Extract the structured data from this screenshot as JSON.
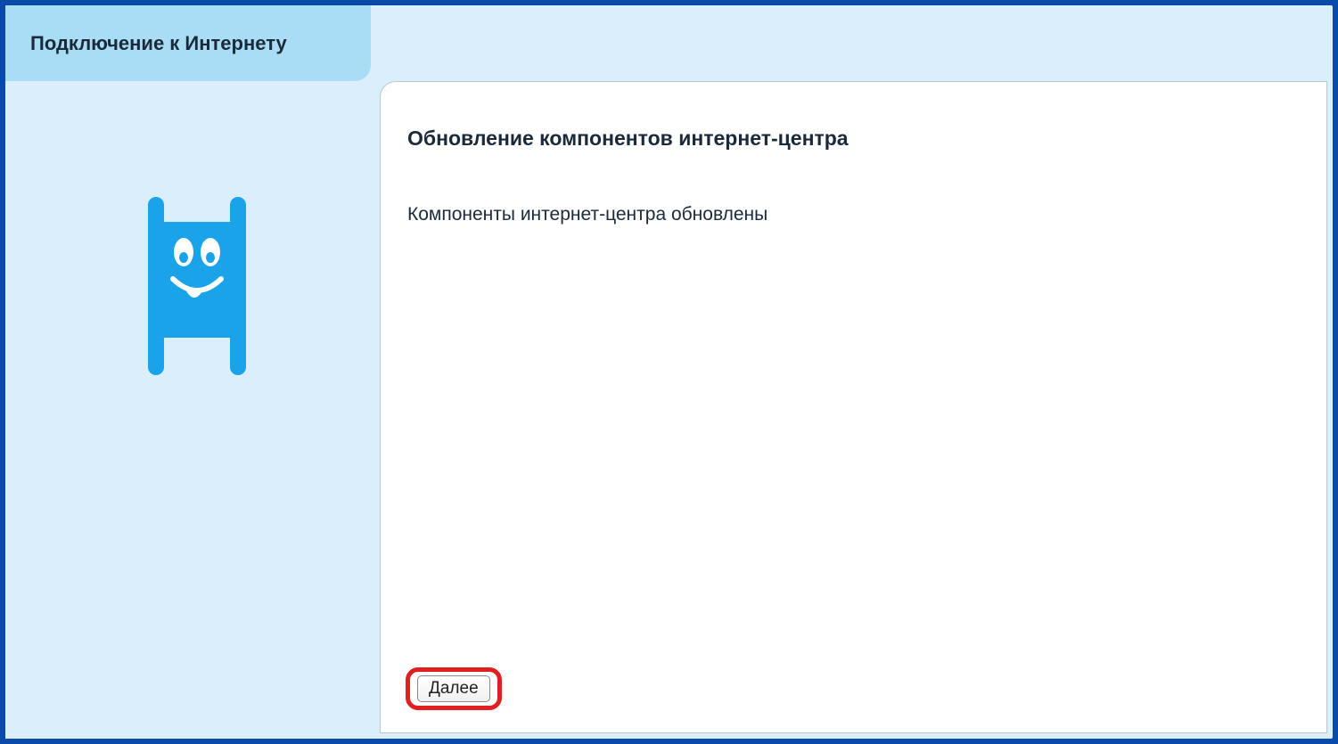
{
  "tab": {
    "title": "Подключение к Интернету"
  },
  "main": {
    "heading": "Обновление компонентов интернет-центра",
    "body": "Компоненты интернет-центра обновлены",
    "next_label": "Далее"
  },
  "colors": {
    "brand_border": "#0a4aa8",
    "panel_bg": "#dbeefc",
    "tab_bg": "#a8ddf5",
    "highlight": "#e02020",
    "mascot": "#1aa3e8"
  }
}
